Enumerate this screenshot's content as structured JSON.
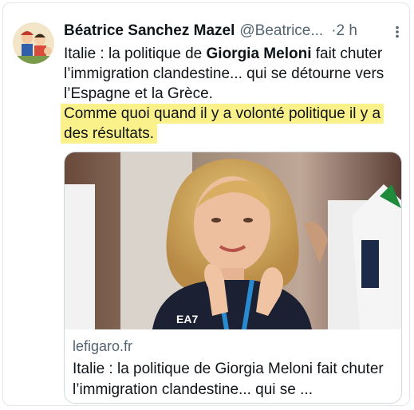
{
  "tweet": {
    "author_name": "Béatrice Sanchez Mazel",
    "handle": "@Beatrice...",
    "separator": "·",
    "time": "2 h",
    "text": {
      "part1": "Italie : la politique de ",
      "bold": "Giorgia Meloni",
      "part2": " fait chuter l’immigration clandestine... qui se détourne vers l’Espagne et la Grèce.",
      "highlighted": "Comme quoi quand il y a volonté politique il y a des résultats."
    },
    "highlight_color": "#fbf18a"
  },
  "link_card": {
    "image_icon": "photo-of-woman-applauding",
    "shirt_text": "EA7",
    "domain": "lefigaro.fr",
    "title": "Italie : la politique de Giorgia Meloni fait chuter l’immigration clandestine... qui se ..."
  },
  "colors": {
    "text": "#0f1419",
    "secondary": "#536471",
    "border": "#cfd9de"
  }
}
